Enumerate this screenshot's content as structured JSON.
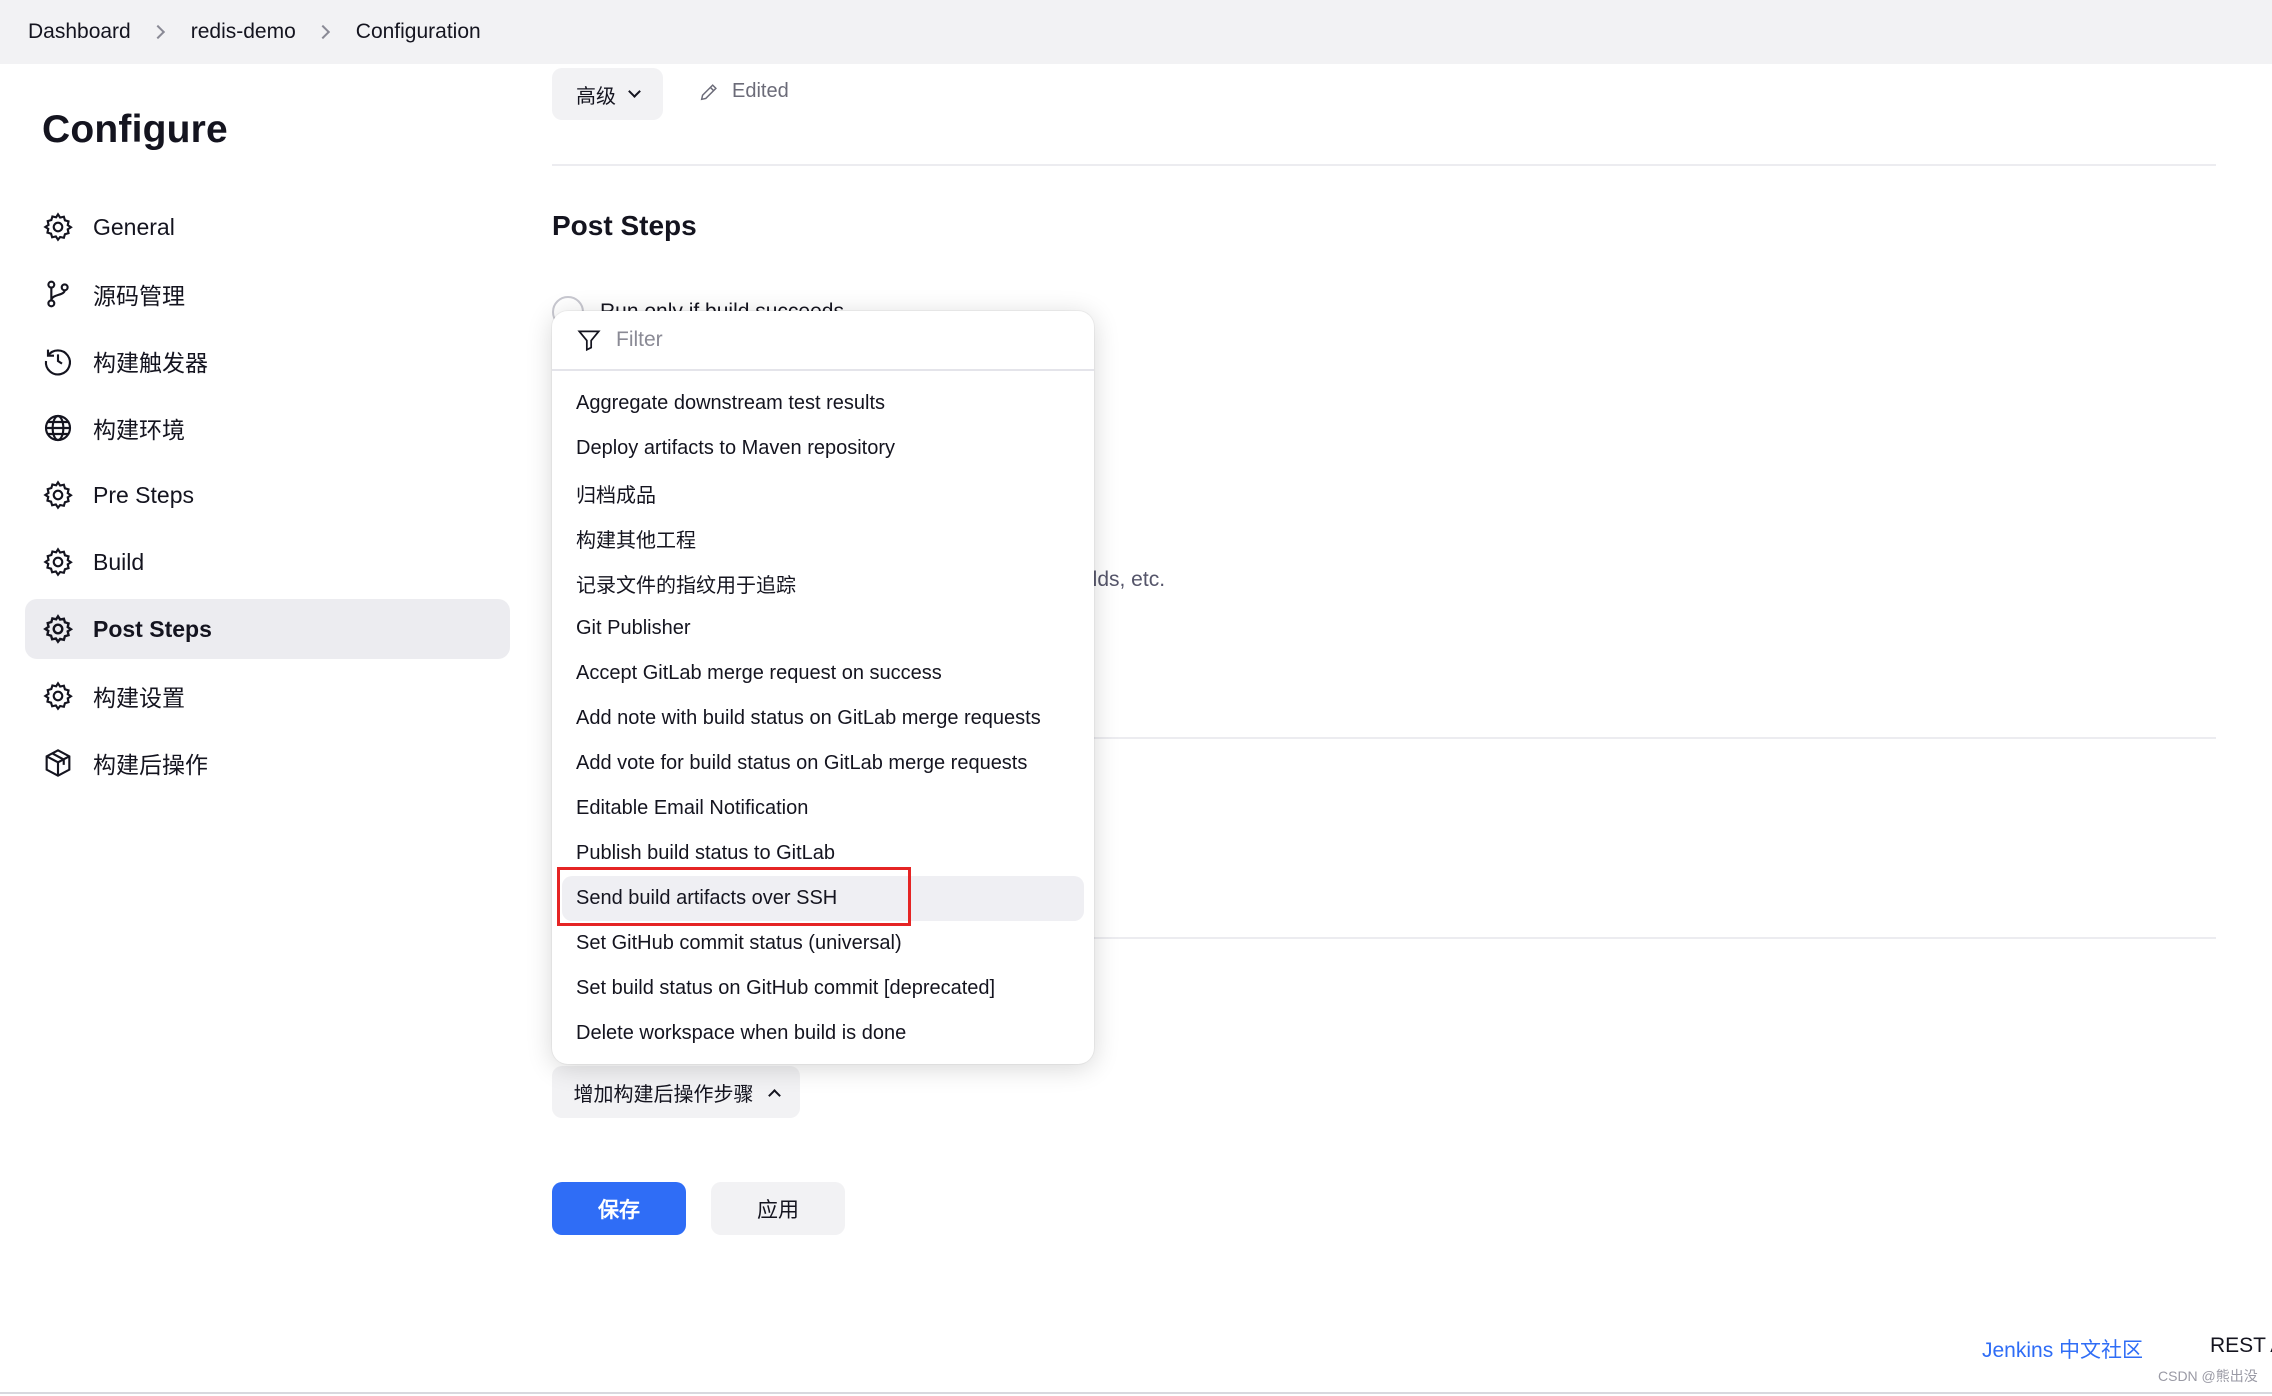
{
  "breadcrumb": {
    "items": [
      "Dashboard",
      "redis-demo",
      "Configuration"
    ]
  },
  "page_title": "Configure",
  "sidebar": {
    "items": [
      {
        "label": "General",
        "icon": "gear-icon",
        "active": false
      },
      {
        "label": "源码管理",
        "icon": "source-branch-icon",
        "active": false
      },
      {
        "label": "构建触发器",
        "icon": "clock-trigger-icon",
        "active": false
      },
      {
        "label": "构建环境",
        "icon": "globe-icon",
        "active": false
      },
      {
        "label": "Pre Steps",
        "icon": "gear-icon",
        "active": false
      },
      {
        "label": "Build",
        "icon": "gear-icon",
        "active": false
      },
      {
        "label": "Post Steps",
        "icon": "gear-icon",
        "active": true
      },
      {
        "label": "构建设置",
        "icon": "gear-icon",
        "active": false
      },
      {
        "label": "构建后操作",
        "icon": "package-icon",
        "active": false
      }
    ]
  },
  "main": {
    "advanced_label": "高级",
    "edited_label": "Edited",
    "section_title": "Post Steps",
    "radio_label": "Run only if build succeeds",
    "behind_text": "ilds, etc.",
    "add_post_build_label": "增加构建后操作步骤",
    "save_label": "保存",
    "apply_label": "应用"
  },
  "dropdown": {
    "filter_placeholder": "Filter",
    "items": [
      "Aggregate downstream test results",
      "Deploy artifacts to Maven repository",
      "归档成品",
      "构建其他工程",
      "记录文件的指纹用于追踪",
      "Git Publisher",
      "Accept GitLab merge request on success",
      "Add note with build status on GitLab merge requests",
      "Add vote for build status on GitLab merge requests",
      "Editable Email Notification",
      "Publish build status to GitLab",
      "Send build artifacts over SSH",
      "Set GitHub commit status (universal)",
      "Set build status on GitHub commit [deprecated]",
      "Delete workspace when build is done"
    ],
    "hovered_item": "Send build artifacts over SSH"
  },
  "footer": {
    "community_link": "Jenkins 中文社区",
    "rest_api_label": "REST A",
    "watermark": "CSDN @熊出没"
  },
  "colors": {
    "accent": "#2f6df6",
    "highlight_border": "#e52424",
    "topbar_bg": "#f2f2f4"
  }
}
